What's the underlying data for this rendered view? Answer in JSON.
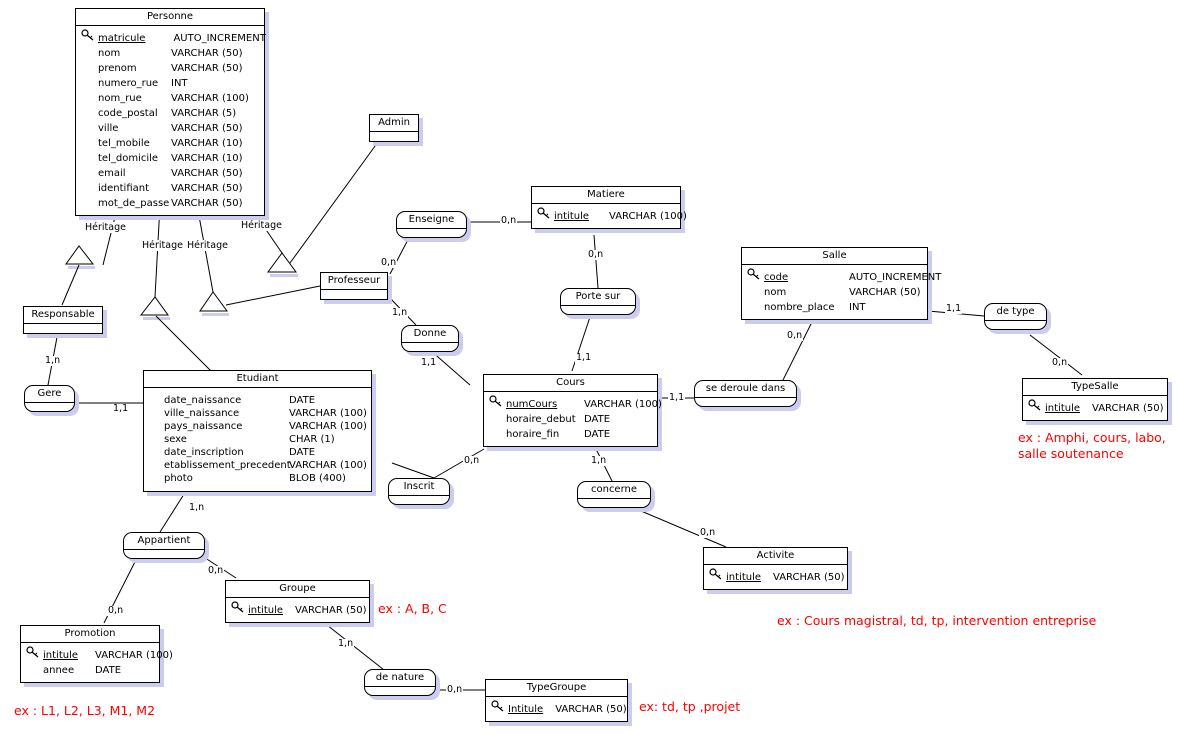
{
  "diagram": {
    "title": "Entity Relationship Diagram",
    "colors": {
      "entity_border": "#000000",
      "entity_fill": "#ffffff",
      "shadow": "#ccccee",
      "note_text": "#ff0000",
      "line": "#000000"
    }
  },
  "entities": [
    {
      "id": "personne",
      "name": "Personne",
      "attributes": [
        {
          "key": true,
          "name": "matricule",
          "type": "AUTO_INCREMENT"
        },
        {
          "key": false,
          "name": "nom",
          "type": "VARCHAR (50)"
        },
        {
          "key": false,
          "name": "prenom",
          "type": "VARCHAR (50)"
        },
        {
          "key": false,
          "name": "numero_rue",
          "type": "INT"
        },
        {
          "key": false,
          "name": "nom_rue",
          "type": "VARCHAR (100)"
        },
        {
          "key": false,
          "name": "code_postal",
          "type": "VARCHAR (5)"
        },
        {
          "key": false,
          "name": "ville",
          "type": "VARCHAR (50)"
        },
        {
          "key": false,
          "name": "tel_mobile",
          "type": "VARCHAR (10)"
        },
        {
          "key": false,
          "name": "tel_domicile",
          "type": "VARCHAR (10)"
        },
        {
          "key": false,
          "name": "email",
          "type": "VARCHAR (50)"
        },
        {
          "key": false,
          "name": "identifiant",
          "type": "VARCHAR (50)"
        },
        {
          "key": false,
          "name": "mot_de_passe",
          "type": "VARCHAR (50)"
        }
      ]
    },
    {
      "id": "admin",
      "name": "Admin",
      "attributes": []
    },
    {
      "id": "responsable",
      "name": "Responsable",
      "attributes": []
    },
    {
      "id": "professeur",
      "name": "Professeur",
      "attributes": []
    },
    {
      "id": "etudiant",
      "name": "Etudiant",
      "attributes": [
        {
          "key": false,
          "name": "date_naissance",
          "type": "DATE"
        },
        {
          "key": false,
          "name": "ville_naissance",
          "type": "VARCHAR (100)"
        },
        {
          "key": false,
          "name": "pays_naissance",
          "type": "VARCHAR (100)"
        },
        {
          "key": false,
          "name": "sexe",
          "type": "CHAR (1)"
        },
        {
          "key": false,
          "name": "date_inscription",
          "type": "DATE"
        },
        {
          "key": false,
          "name": "etablissement_precedent",
          "type": "VARCHAR (100)"
        },
        {
          "key": false,
          "name": "photo",
          "type": "BLOB (400)"
        }
      ]
    },
    {
      "id": "matiere",
      "name": "Matiere",
      "attributes": [
        {
          "key": true,
          "name": "intitule",
          "type": "VARCHAR (100)"
        }
      ]
    },
    {
      "id": "cours",
      "name": "Cours",
      "attributes": [
        {
          "key": true,
          "name": "numCours",
          "type": "VARCHAR (100)"
        },
        {
          "key": false,
          "name": "horaire_debut",
          "type": "DATE"
        },
        {
          "key": false,
          "name": "horaire_fin",
          "type": "DATE"
        }
      ]
    },
    {
      "id": "salle",
      "name": "Salle",
      "attributes": [
        {
          "key": true,
          "name": "code",
          "type": "AUTO_INCREMENT"
        },
        {
          "key": false,
          "name": "nom",
          "type": "VARCHAR (50)"
        },
        {
          "key": false,
          "name": "nombre_place",
          "type": "INT"
        }
      ]
    },
    {
      "id": "typesalle",
      "name": "TypeSalle",
      "attributes": [
        {
          "key": true,
          "name": "intitule",
          "type": "VARCHAR (50)"
        }
      ]
    },
    {
      "id": "activite",
      "name": "Activite",
      "attributes": [
        {
          "key": true,
          "name": "intitule",
          "type": "VARCHAR (50)"
        }
      ]
    },
    {
      "id": "groupe",
      "name": "Groupe",
      "attributes": [
        {
          "key": true,
          "name": "intitule",
          "type": "VARCHAR (50)"
        }
      ]
    },
    {
      "id": "typegroupe",
      "name": "TypeGroupe",
      "attributes": [
        {
          "key": true,
          "name": "Intitule",
          "type": "VARCHAR (50)"
        }
      ]
    },
    {
      "id": "promotion",
      "name": "Promotion",
      "attributes": [
        {
          "key": true,
          "name": "intitule",
          "type": "VARCHAR (100)"
        },
        {
          "key": false,
          "name": "annee",
          "type": "DATE"
        }
      ]
    }
  ],
  "relationships": [
    {
      "id": "enseigne",
      "name": "Enseigne"
    },
    {
      "id": "donne",
      "name": "Donne"
    },
    {
      "id": "porte_sur",
      "name": "Porte sur"
    },
    {
      "id": "se_deroule_dans",
      "name": "se deroule dans"
    },
    {
      "id": "de_type",
      "name": "de type"
    },
    {
      "id": "gere",
      "name": "Gere"
    },
    {
      "id": "inscrit",
      "name": "Inscrit"
    },
    {
      "id": "concerne",
      "name": "concerne"
    },
    {
      "id": "appartient",
      "name": "Appartient"
    },
    {
      "id": "de_nature",
      "name": "de nature"
    }
  ],
  "cardinalities": [
    {
      "id": "c_prof_enseigne",
      "text": "0,n"
    },
    {
      "id": "c_enseigne_mat",
      "text": "0,n"
    },
    {
      "id": "c_prof_donne",
      "text": "1,n"
    },
    {
      "id": "c_donne_cours",
      "text": "1,1"
    },
    {
      "id": "c_matiere_porte",
      "text": "0,n"
    },
    {
      "id": "c_porte_cours",
      "text": "1,1"
    },
    {
      "id": "c_cours_sdd",
      "text": "1,1"
    },
    {
      "id": "c_salle_sdd",
      "text": "0,n"
    },
    {
      "id": "c_salle_detype",
      "text": "1,1"
    },
    {
      "id": "c_detype_ts",
      "text": "0,n"
    },
    {
      "id": "c_resp_gere",
      "text": "1,n"
    },
    {
      "id": "c_gere_etu",
      "text": "1,1"
    },
    {
      "id": "c_etu_inscrit",
      "text": "0,n"
    },
    {
      "id": "c_cours_concerne",
      "text": "1,n"
    },
    {
      "id": "c_concerne_act",
      "text": "0,n"
    },
    {
      "id": "c_etu_appartient",
      "text": "1,n"
    },
    {
      "id": "c_appart_groupe",
      "text": "0,n"
    },
    {
      "id": "c_appart_promo",
      "text": "0,n"
    },
    {
      "id": "c_groupe_nature",
      "text": "1,n"
    },
    {
      "id": "c_nature_tg",
      "text": "0,n"
    }
  ],
  "inheritance_labels": [
    {
      "id": "h1",
      "text": "Héritage"
    },
    {
      "id": "h2",
      "text": "Héritage"
    },
    {
      "id": "h3",
      "text": "Héritage"
    },
    {
      "id": "h4",
      "text": "Héritage"
    }
  ],
  "notes": [
    {
      "id": "note_typesalle",
      "text": "ex : Amphi, cours, labo,\nsalle soutenance"
    },
    {
      "id": "note_activite",
      "text": "ex : Cours magistral, td, tp, intervention entreprise"
    },
    {
      "id": "note_groupe",
      "text": "ex : A, B, C"
    },
    {
      "id": "note_typegroupe",
      "text": "ex: td, tp ,projet"
    },
    {
      "id": "note_promotion",
      "text": "ex : L1, L2, L3, M1, M2"
    }
  ]
}
